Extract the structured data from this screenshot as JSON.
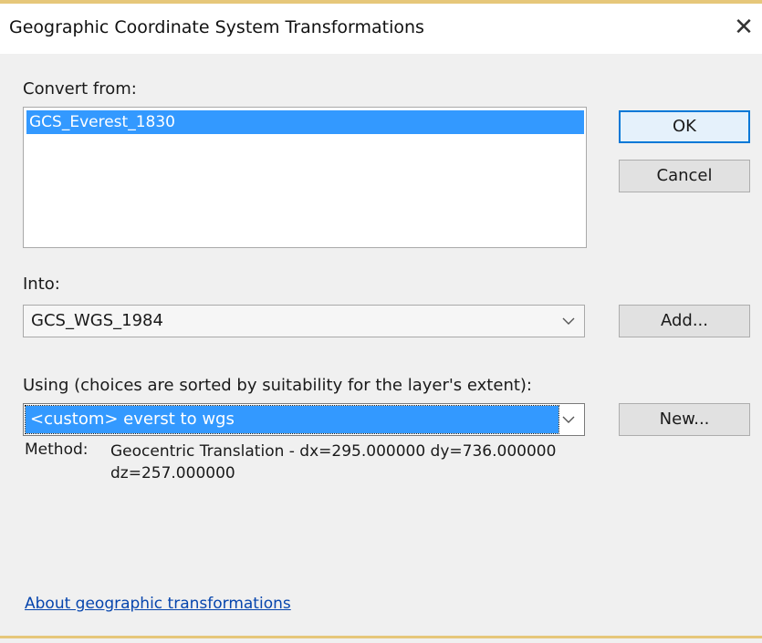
{
  "window": {
    "title": "Geographic Coordinate System Transformations"
  },
  "convert_from": {
    "label": "Convert from:",
    "items": [
      "GCS_Everest_1830"
    ]
  },
  "into": {
    "label": "Into:",
    "value": "GCS_WGS_1984"
  },
  "using": {
    "label": "Using (choices are sorted by suitability for the layer's extent):",
    "value": "<custom> everst to wgs"
  },
  "buttons": {
    "ok": "OK",
    "cancel": "Cancel",
    "add": "Add...",
    "new": "New..."
  },
  "method": {
    "label": "Method:",
    "text": "Geocentric Translation - dx=295.000000 dy=736.000000 dz=257.000000"
  },
  "link": {
    "text": "About geographic transformations"
  },
  "icons": {
    "close": "close-icon",
    "dropdown": "chevron-down-icon"
  }
}
